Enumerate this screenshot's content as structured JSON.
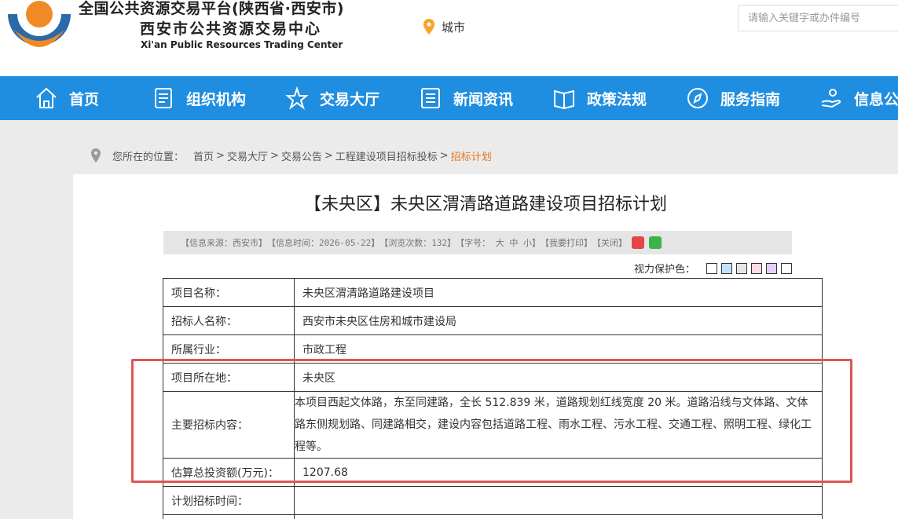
{
  "header": {
    "title": "全国公共资源交易平台(陕西省·西安市)",
    "subtitle": "西安市公共资源交易中心",
    "english": "Xi'an Public Resources Trading Center",
    "city_label": "城市",
    "search_placeholder": "请输入关键字或办件编号",
    "logo_colors": {
      "blue": "#2a6aa8",
      "orange": "#f08a24"
    }
  },
  "nav": {
    "background": "#1f8ee0",
    "items": [
      {
        "label": "首页",
        "icon": "home-icon"
      },
      {
        "label": "组织机构",
        "icon": "document-icon"
      },
      {
        "label": "交易大厅",
        "icon": "hall-icon"
      },
      {
        "label": "新闻资讯",
        "icon": "news-icon"
      },
      {
        "label": "政策法规",
        "icon": "book-icon"
      },
      {
        "label": "服务指南",
        "icon": "compass-icon"
      },
      {
        "label": "信息公开",
        "icon": "hand-icon"
      }
    ]
  },
  "breadcrumb": {
    "prefix": "您所在的位置：",
    "items": [
      "首页",
      "交易大厅",
      "交易公告",
      "工程建设项目招标投标"
    ],
    "separator": ">",
    "current": "招标计划"
  },
  "article": {
    "title": "【未央区】未央区渭清路道路建设项目招标计划",
    "source": "【信息来源：西安市】",
    "time": "【信息时间：2026-05-22】",
    "views": "【浏览次数：132】",
    "font_size": "【字号： 大 中 小】",
    "print": "【我要打印】",
    "close": "【关闭】",
    "vision_label": "视力保护色：",
    "vision_colors": [
      "#ffffff",
      "#bfe3ff",
      "#e6e6e6",
      "#ffd9e6",
      "#e6ccff",
      "#ffffff"
    ]
  },
  "table": {
    "rows": [
      {
        "key": "项目名称：",
        "value": "未央区渭清路道路建设项目"
      },
      {
        "key": "招标人名称：",
        "value": "西安市未央区住房和城市建设局"
      },
      {
        "key": "所属行业：",
        "value": "市政工程"
      },
      {
        "key": "项目所在地：",
        "value": "未央区"
      },
      {
        "key": "主要招标内容：",
        "value": "本项目西起文体路，东至同建路，全长 512.839 米，道路规划红线宽度 20 米。道路沿线与文体路、文体路东侧规划路、同建路相交，建设内容包括道路工程、雨水工程、污水工程、交通工程、照明工程、绿化工程等。"
      },
      {
        "key": "估算总投资额(万元)：",
        "value": "1207.68"
      },
      {
        "key": "计划招标时间：",
        "value": ""
      },
      {
        "key": "",
        "value": ""
      }
    ]
  }
}
